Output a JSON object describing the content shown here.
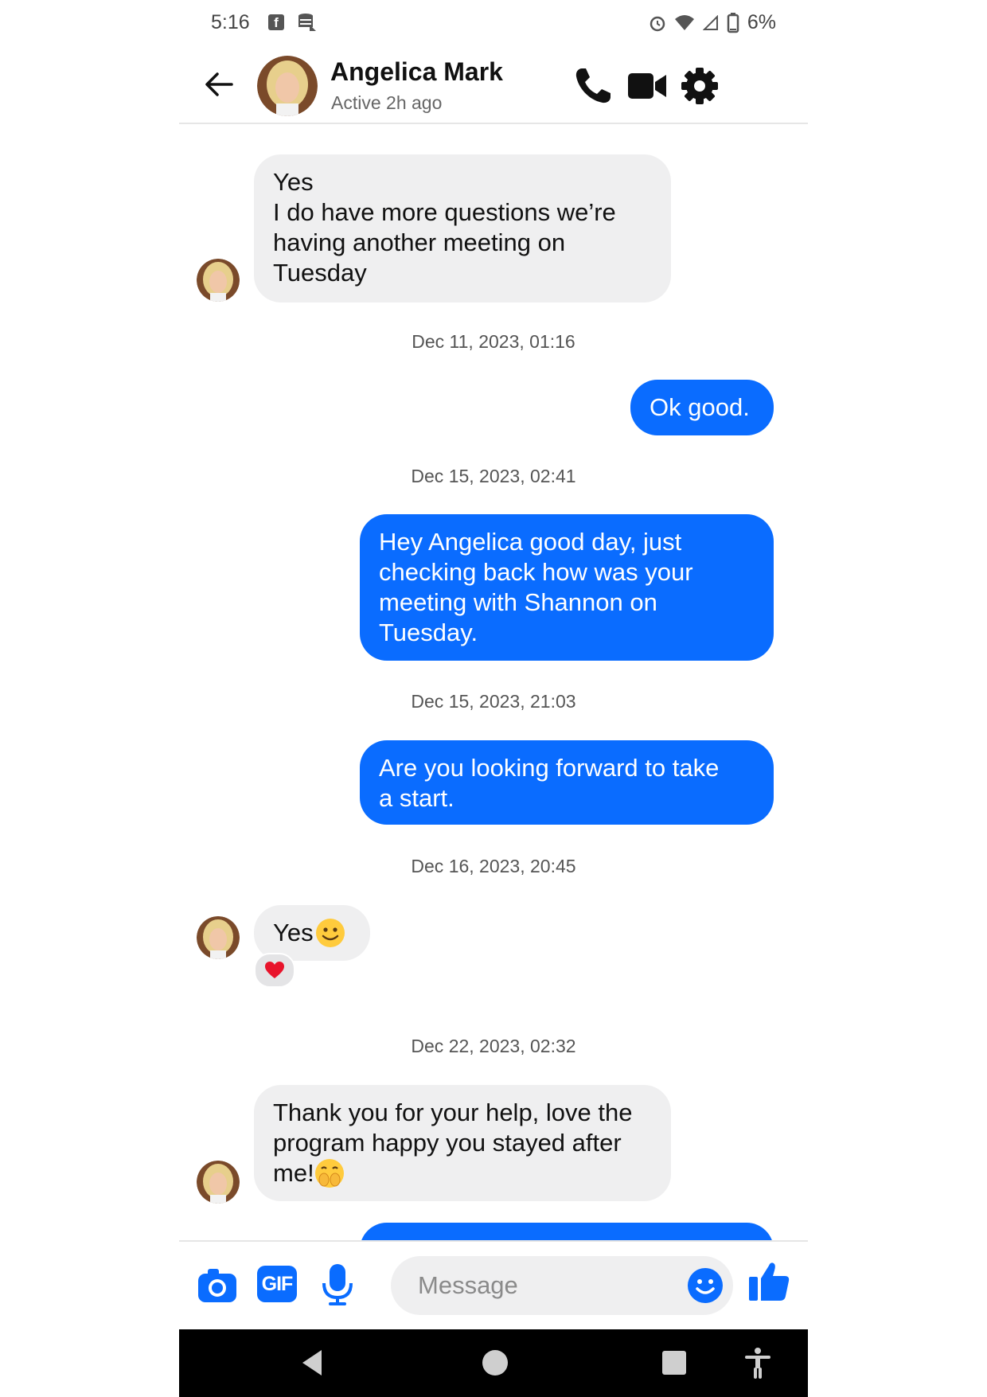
{
  "status_bar": {
    "time": "5:16",
    "battery": "6%"
  },
  "header": {
    "contact_name": "Angelica Mark",
    "active_status": "Active 2h ago"
  },
  "messages": [
    {
      "type": "in",
      "lines": [
        "Yes",
        "I do have more questions we’re",
        "having another meeting on",
        "Tuesday"
      ]
    },
    {
      "type": "timestamp",
      "text": "Dec 11, 2023, 01:16"
    },
    {
      "type": "out",
      "lines": [
        "Ok good."
      ]
    },
    {
      "type": "timestamp",
      "text": "Dec 15, 2023, 02:41"
    },
    {
      "type": "out",
      "lines": [
        "Hey Angelica good day, just",
        "checking back how was your",
        "meeting with Shannon on",
        "Tuesday."
      ]
    },
    {
      "type": "timestamp",
      "text": "Dec 15, 2023, 21:03"
    },
    {
      "type": "out",
      "lines": [
        "Are you looking forward to take",
        "a start."
      ]
    },
    {
      "type": "timestamp",
      "text": "Dec 16, 2023, 20:45"
    },
    {
      "type": "in",
      "text": "Yes",
      "emoji": "slightly-smiling-face",
      "reaction": "heart"
    },
    {
      "type": "timestamp",
      "text": "Dec 22, 2023, 02:32"
    },
    {
      "type": "in",
      "lines": [
        "Thank you for your help, love the",
        "program happy you stayed after",
        "me!"
      ],
      "emoji": "face-with-hand-over-mouth"
    }
  ],
  "composer": {
    "placeholder": "Message",
    "gif_label": "GIF"
  },
  "colors": {
    "accent": "#0a6cff",
    "incoming_bubble": "#efeff0"
  }
}
